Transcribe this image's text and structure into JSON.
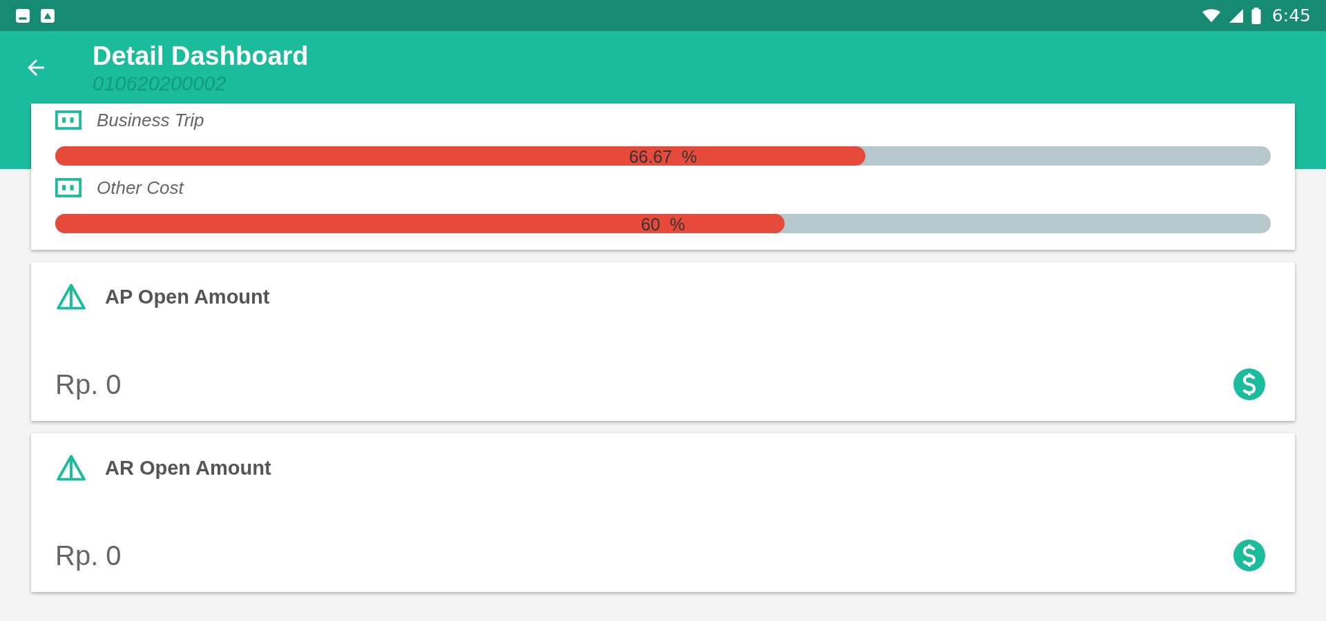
{
  "status_bar": {
    "time": "6:45"
  },
  "app_bar": {
    "title": "Detail Dashboard",
    "subtitle": "010620200002"
  },
  "budget_items": [
    {
      "label": "Business Trip",
      "level": 0.6667,
      "percent": "66.67  %"
    },
    {
      "label": "Other Cost",
      "level": 0.6,
      "percent": "60  %"
    }
  ],
  "cards": [
    {
      "title": "AP Open Amount",
      "amount": "Rp. 0"
    },
    {
      "title": "AR Open Amount",
      "amount": "Rp. 0"
    }
  ]
}
